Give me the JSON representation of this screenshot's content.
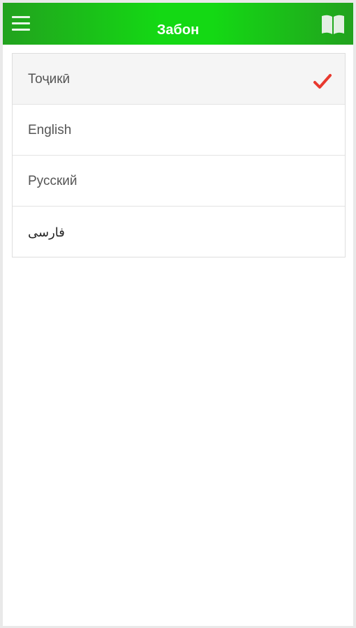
{
  "header": {
    "title": "Забон",
    "menu_icon": "hamburger-menu-icon",
    "book_icon": "open-book-icon"
  },
  "languages": {
    "selected_index": 0,
    "items": [
      {
        "label": "Тоҷикӣ",
        "selected": true
      },
      {
        "label": "English",
        "selected": false
      },
      {
        "label": "Русский",
        "selected": false
      },
      {
        "label": "فارسی",
        "selected": false
      }
    ]
  },
  "colors": {
    "appbar_light": "#14d914",
    "appbar_dark": "#22a21e",
    "check": "#e8392e"
  }
}
